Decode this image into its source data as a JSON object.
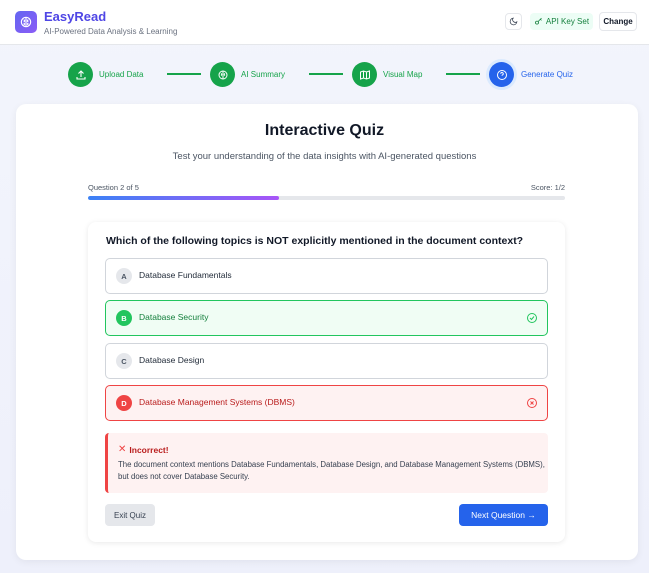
{
  "header": {
    "app_title": "EasyRead",
    "app_subtitle": "AI-Powered Data Analysis & Learning",
    "api_key_label": "API Key Set",
    "change_label": "Change",
    "theme_icon": "moon-icon",
    "logo_icon": "brain-icon"
  },
  "stepper": {
    "steps": [
      {
        "label": "Upload Data",
        "icon": "upload-icon",
        "status": "done"
      },
      {
        "label": "AI Summary",
        "icon": "brain-icon",
        "status": "done"
      },
      {
        "label": "Visual Map",
        "icon": "map-icon",
        "status": "done"
      },
      {
        "label": "Generate Quiz",
        "icon": "help-circle-icon",
        "status": "active"
      }
    ]
  },
  "quiz": {
    "title": "Interactive Quiz",
    "subtitle": "Test your understanding of the data insights with AI-generated questions",
    "progress_text": "Question 2 of 5",
    "score_text": "Score: 1/2",
    "progress_fraction": 0.4,
    "question": "Which of the following topics is NOT explicitly mentioned in the document context?",
    "options": [
      {
        "letter": "A",
        "text": "Database Fundamentals",
        "state": "neutral"
      },
      {
        "letter": "B",
        "text": "Database Security",
        "state": "correct"
      },
      {
        "letter": "C",
        "text": "Database Design",
        "state": "neutral"
      },
      {
        "letter": "D",
        "text": "Database Management Systems (DBMS)",
        "state": "wrong"
      }
    ],
    "feedback": {
      "title": "Incorrect!",
      "text": "The document context mentions Database Fundamentals, Database Design, and Database Management Systems (DBMS), but does not cover Database Security."
    },
    "exit_label": "Exit Quiz",
    "next_label": "Next Question →"
  },
  "colors": {
    "brand": "#4f46e5",
    "success": "#16a34a",
    "active": "#2563eb",
    "error": "#ef4444"
  }
}
